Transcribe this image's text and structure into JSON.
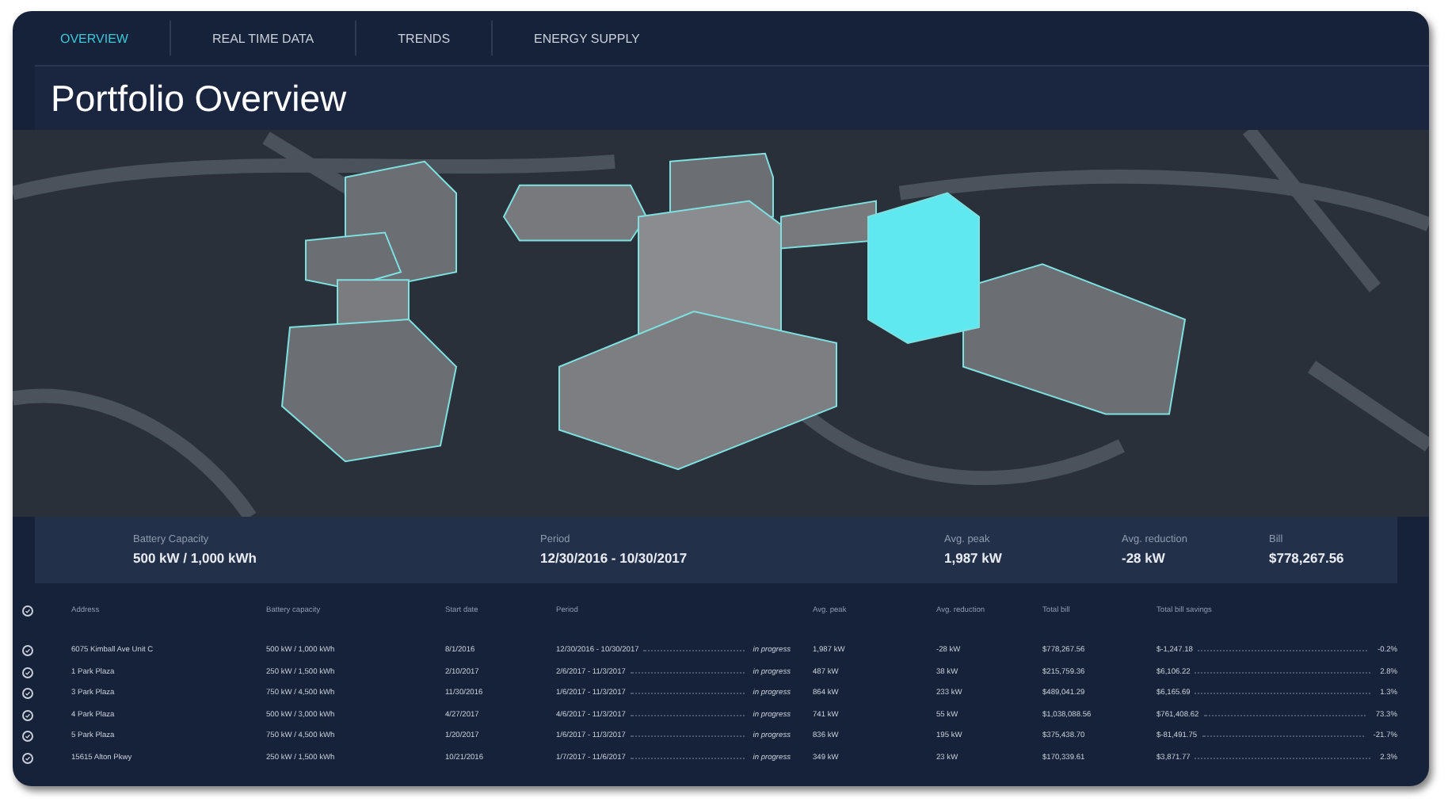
{
  "tabs": [
    {
      "label": "OVERVIEW",
      "selected": true
    },
    {
      "label": "REAL TIME DATA",
      "selected": false
    },
    {
      "label": "TRENDS",
      "selected": false
    },
    {
      "label": "ENERGY SUPPLY",
      "selected": false
    }
  ],
  "title": "Portfolio Overview",
  "summary": [
    {
      "label": "Battery Capacity",
      "value": "500 kW / 1,000 kWh"
    },
    {
      "label": "Period",
      "value": "12/30/2016 - 10/30/2017"
    },
    {
      "label": "Avg. peak",
      "value": "1,987 kW"
    },
    {
      "label": "Avg. reduction",
      "value": "-28 kW"
    },
    {
      "label": "Bill",
      "value": "$778,267.56"
    }
  ],
  "table": {
    "all_checked": true,
    "columns": [
      "Address",
      "Battery capacity",
      "Start date",
      "Period",
      "Avg. peak",
      "Avg. reduction",
      "Total bill",
      "Total bill savings"
    ],
    "rows": [
      {
        "checked": true,
        "address": "6075 Kimball Ave Unit C",
        "battery": "500 kW / 1,000 kWh",
        "start": "8/1/2016",
        "period": "12/30/2016 - 10/30/2017",
        "status": "in progress",
        "peak": "1,987 kW",
        "reduction": "-28 kW",
        "bill": "$778,267.56",
        "savings": "$-1,247.18",
        "pct": "-0.2%"
      },
      {
        "checked": true,
        "address": "1 Park Plaza",
        "battery": "250 kW / 1,500 kWh",
        "start": "2/10/2017",
        "period": "2/6/2017 - 11/3/2017",
        "status": "in progress",
        "peak": "487 kW",
        "reduction": "38 kW",
        "bill": "$215,759.36",
        "savings": "$6,106.22",
        "pct": "2.8%"
      },
      {
        "checked": true,
        "address": "3 Park Plaza",
        "battery": "750 kW / 4,500 kWh",
        "start": "11/30/2016",
        "period": "1/6/2017 - 11/3/2017",
        "status": "in progress",
        "peak": "864 kW",
        "reduction": "233 kW",
        "bill": "$489,041.29",
        "savings": "$6,165.69",
        "pct": "1.3%"
      },
      {
        "checked": true,
        "address": "4 Park Plaza",
        "battery": "500 kW / 3,000 kWh",
        "start": "4/27/2017",
        "period": "4/6/2017 - 11/3/2017",
        "status": "in progress",
        "peak": "741 kW",
        "reduction": "55 kW",
        "bill": "$1,038,088.56",
        "savings": "$761,408.62",
        "pct": "73.3%"
      },
      {
        "checked": true,
        "address": "5 Park Plaza",
        "battery": "750 kW / 4,500 kWh",
        "start": "1/20/2017",
        "period": "1/6/2017 - 11/3/2017",
        "status": "in progress",
        "peak": "836 kW",
        "reduction": "195 kW",
        "bill": "$375,438.70",
        "savings": "$-81,491.75",
        "pct": "-21.7%"
      },
      {
        "checked": true,
        "address": "15615 Alton Pkwy",
        "battery": "250 kW / 1,500 kWh",
        "start": "10/21/2016",
        "period": "1/7/2017 - 11/6/2017",
        "status": "in progress",
        "peak": "349 kW",
        "reduction": "23 kW",
        "bill": "$170,339.61",
        "savings": "$3,871.77",
        "pct": "2.3%"
      }
    ]
  }
}
